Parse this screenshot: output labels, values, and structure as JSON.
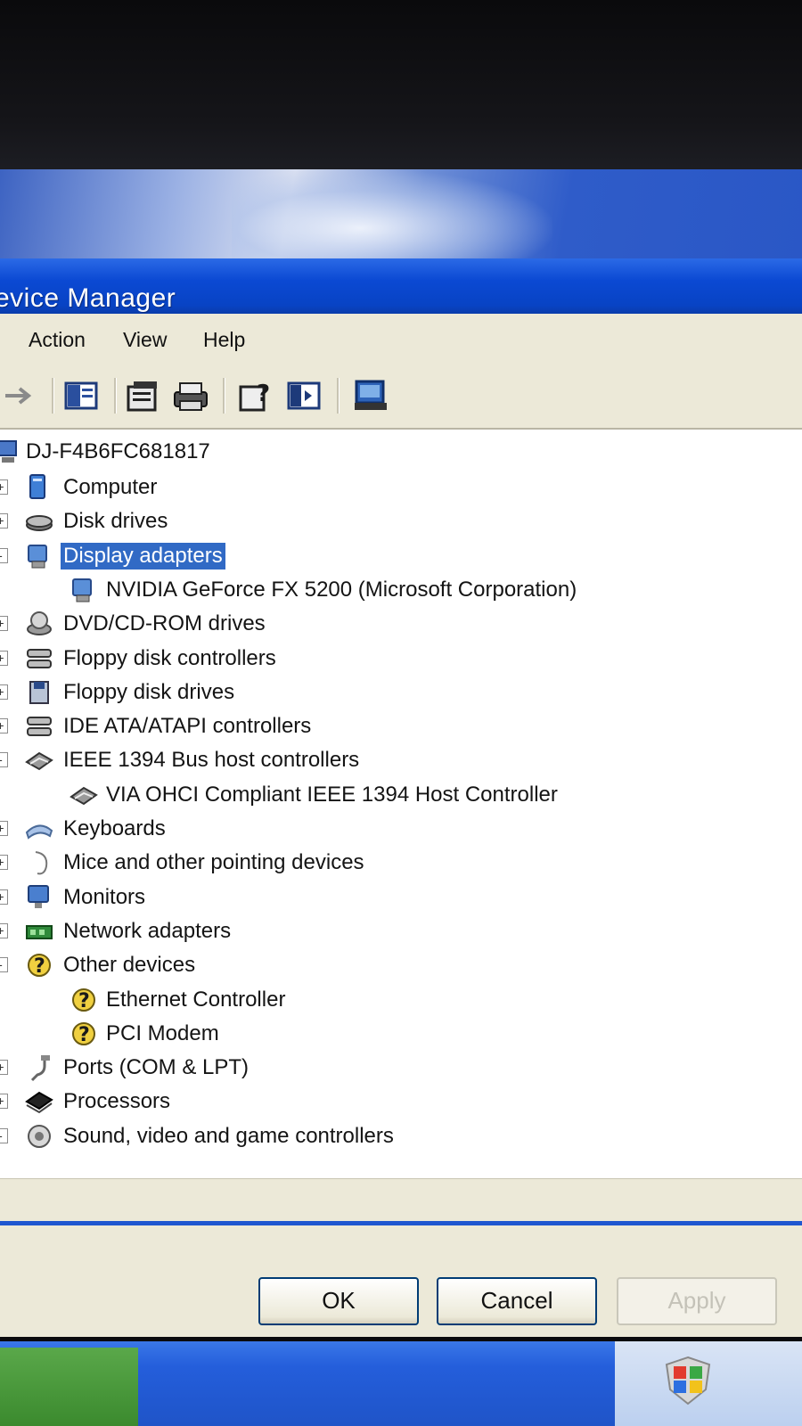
{
  "window": {
    "title": "evice Manager"
  },
  "menu": {
    "items": [
      "Action",
      "View",
      "Help"
    ]
  },
  "toolbar": {
    "buttons": [
      "back-icon",
      "show-hide-tree-icon",
      "properties-icon",
      "print-icon",
      "help-icon",
      "console-tree-icon",
      "scan-hardware-icon"
    ]
  },
  "tree": {
    "root": "DJ-F4B6FC681817",
    "items": [
      {
        "label": "Computer",
        "icon": "computer-icon",
        "expander": "+"
      },
      {
        "label": "Disk drives",
        "icon": "disk-drive-icon",
        "expander": "+"
      },
      {
        "label": "Display adapters",
        "icon": "display-adapter-icon",
        "expander": "-",
        "selected": true
      },
      {
        "label": "NVIDIA GeForce FX 5200  (Microsoft Corporation)",
        "icon": "display-adapter-icon",
        "child": true
      },
      {
        "label": "DVD/CD-ROM drives",
        "icon": "cdrom-icon",
        "expander": "+"
      },
      {
        "label": "Floppy disk controllers",
        "icon": "controller-icon",
        "expander": "+"
      },
      {
        "label": "Floppy disk drives",
        "icon": "floppy-icon",
        "expander": "+"
      },
      {
        "label": "IDE ATA/ATAPI controllers",
        "icon": "controller-icon",
        "expander": "+"
      },
      {
        "label": "IEEE 1394 Bus host controllers",
        "icon": "bus-controller-icon",
        "expander": "-"
      },
      {
        "label": "VIA OHCI Compliant IEEE 1394 Host Controller",
        "icon": "bus-controller-icon",
        "child": true
      },
      {
        "label": "Keyboards",
        "icon": "keyboard-icon",
        "expander": "+"
      },
      {
        "label": "Mice and other pointing devices",
        "icon": "mouse-icon",
        "expander": "+"
      },
      {
        "label": "Monitors",
        "icon": "monitor-icon",
        "expander": "+"
      },
      {
        "label": "Network adapters",
        "icon": "network-adapter-icon",
        "expander": "+"
      },
      {
        "label": "Other devices",
        "icon": "unknown-device-icon",
        "expander": "-"
      },
      {
        "label": "Ethernet Controller",
        "icon": "unknown-device-icon",
        "child": true
      },
      {
        "label": "PCI Modem",
        "icon": "unknown-device-icon",
        "child": true
      },
      {
        "label": "Ports (COM & LPT)",
        "icon": "port-icon",
        "expander": "+"
      },
      {
        "label": "Processors",
        "icon": "processor-icon",
        "expander": "+"
      },
      {
        "label": "Sound, video and game controllers",
        "icon": "sound-icon",
        "expander": "-"
      }
    ]
  },
  "dialog": {
    "ok_label": "OK",
    "cancel_label": "Cancel",
    "apply_label": "Apply"
  },
  "colors": {
    "title_bar": "#0b49d3",
    "selection": "#316ac5",
    "window_face": "#ece9d8"
  }
}
